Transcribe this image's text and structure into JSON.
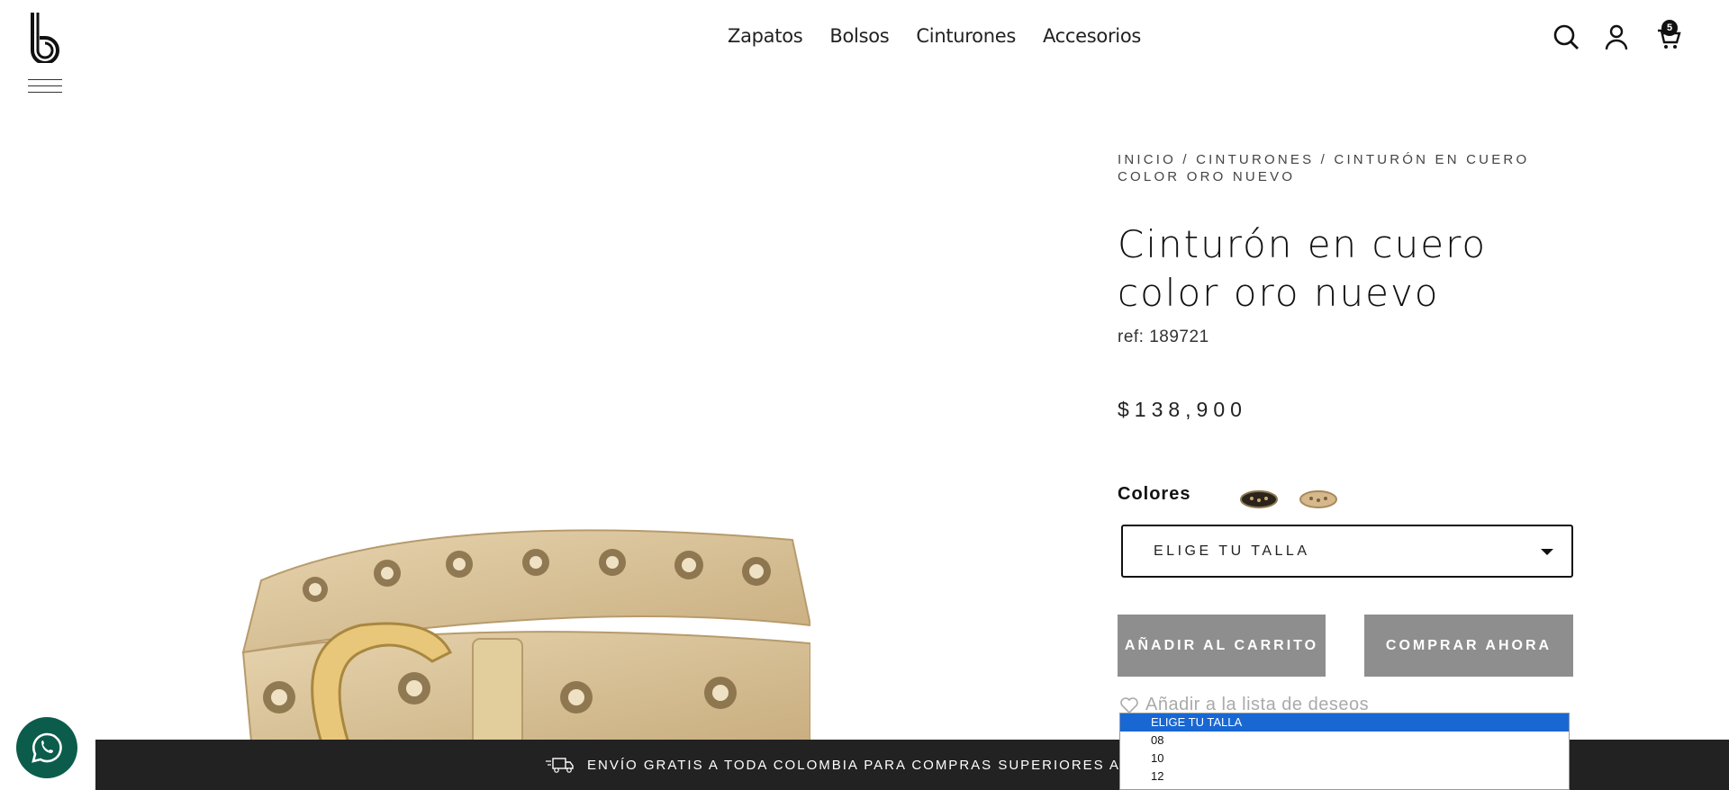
{
  "header": {
    "nav": [
      "Zapatos",
      "Bolsos",
      "Cinturones",
      "Accesorios"
    ],
    "cart_count": "5",
    "icons": [
      "logo-b-icon",
      "hamburger-menu-icon",
      "search-icon",
      "user-icon",
      "cart-icon"
    ]
  },
  "product": {
    "breadcrumb": "INICIO / CINTURONES / CINTURÓN EN CUERO COLOR ORO NUEVO",
    "title": "Cinturón en cuero color oro nuevo",
    "ref": "ref: 189721",
    "price": "$138,900",
    "colors_label": "Colores",
    "size_placeholder": "ELIGE TU TALLA",
    "add_to_cart": "AÑADIR AL CARRITO",
    "buy_now": "COMPRAR AHORA",
    "wishlist": "Añadir a la lista de deseos"
  },
  "size_dropdown": {
    "options": [
      "ELIGE TU TALLA",
      "08",
      "10",
      "12"
    ],
    "selected": "ELIGE TU TALLA"
  },
  "shipping_banner": "ENVÍO GRATIS A TODA COLOMBIA PARA COMPRAS SUPERIORES A $ 100,000",
  "colors": {
    "accent_dark": "#222222",
    "button_gray": "#8e8e8e",
    "whatsapp_green": "#0c5c4c",
    "dropdown_selected": "#1967d2",
    "belt_gold": "#d8c29a"
  }
}
